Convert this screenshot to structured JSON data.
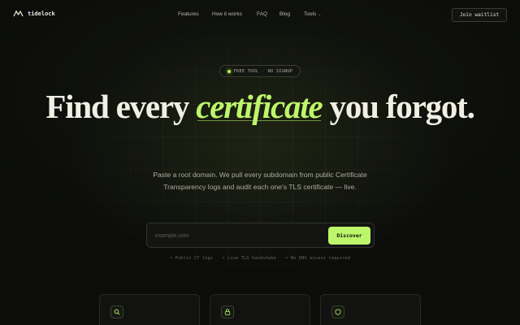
{
  "nav": {
    "logo_text": "tidelock",
    "links": [
      "Features",
      "How it works",
      "FAQ",
      "Blog",
      "Tools"
    ],
    "cta": "Join waitlist"
  },
  "badge": {
    "left": "FREE TOOL",
    "separator": "·",
    "right": "NO SIGNUP"
  },
  "hero": {
    "title_before": "Find every ",
    "title_accent": "certificate",
    "title_after": " you forgot.",
    "subtitle": "Paste a root domain. We pull every subdomain from public Certificate Transparency logs and audit each one's TLS certificate — live."
  },
  "search": {
    "placeholder": "example.com",
    "value": "",
    "button": "Discover"
  },
  "features": [
    "• Public CT logs",
    "• Live TLS handshake",
    "• No DNS access required"
  ],
  "cards": [
    {
      "icon": "search-icon"
    },
    {
      "icon": "lock-icon"
    },
    {
      "icon": "shield-icon"
    }
  ],
  "colors": {
    "accent": "#bdf66a",
    "background": "#0c0d0b"
  }
}
